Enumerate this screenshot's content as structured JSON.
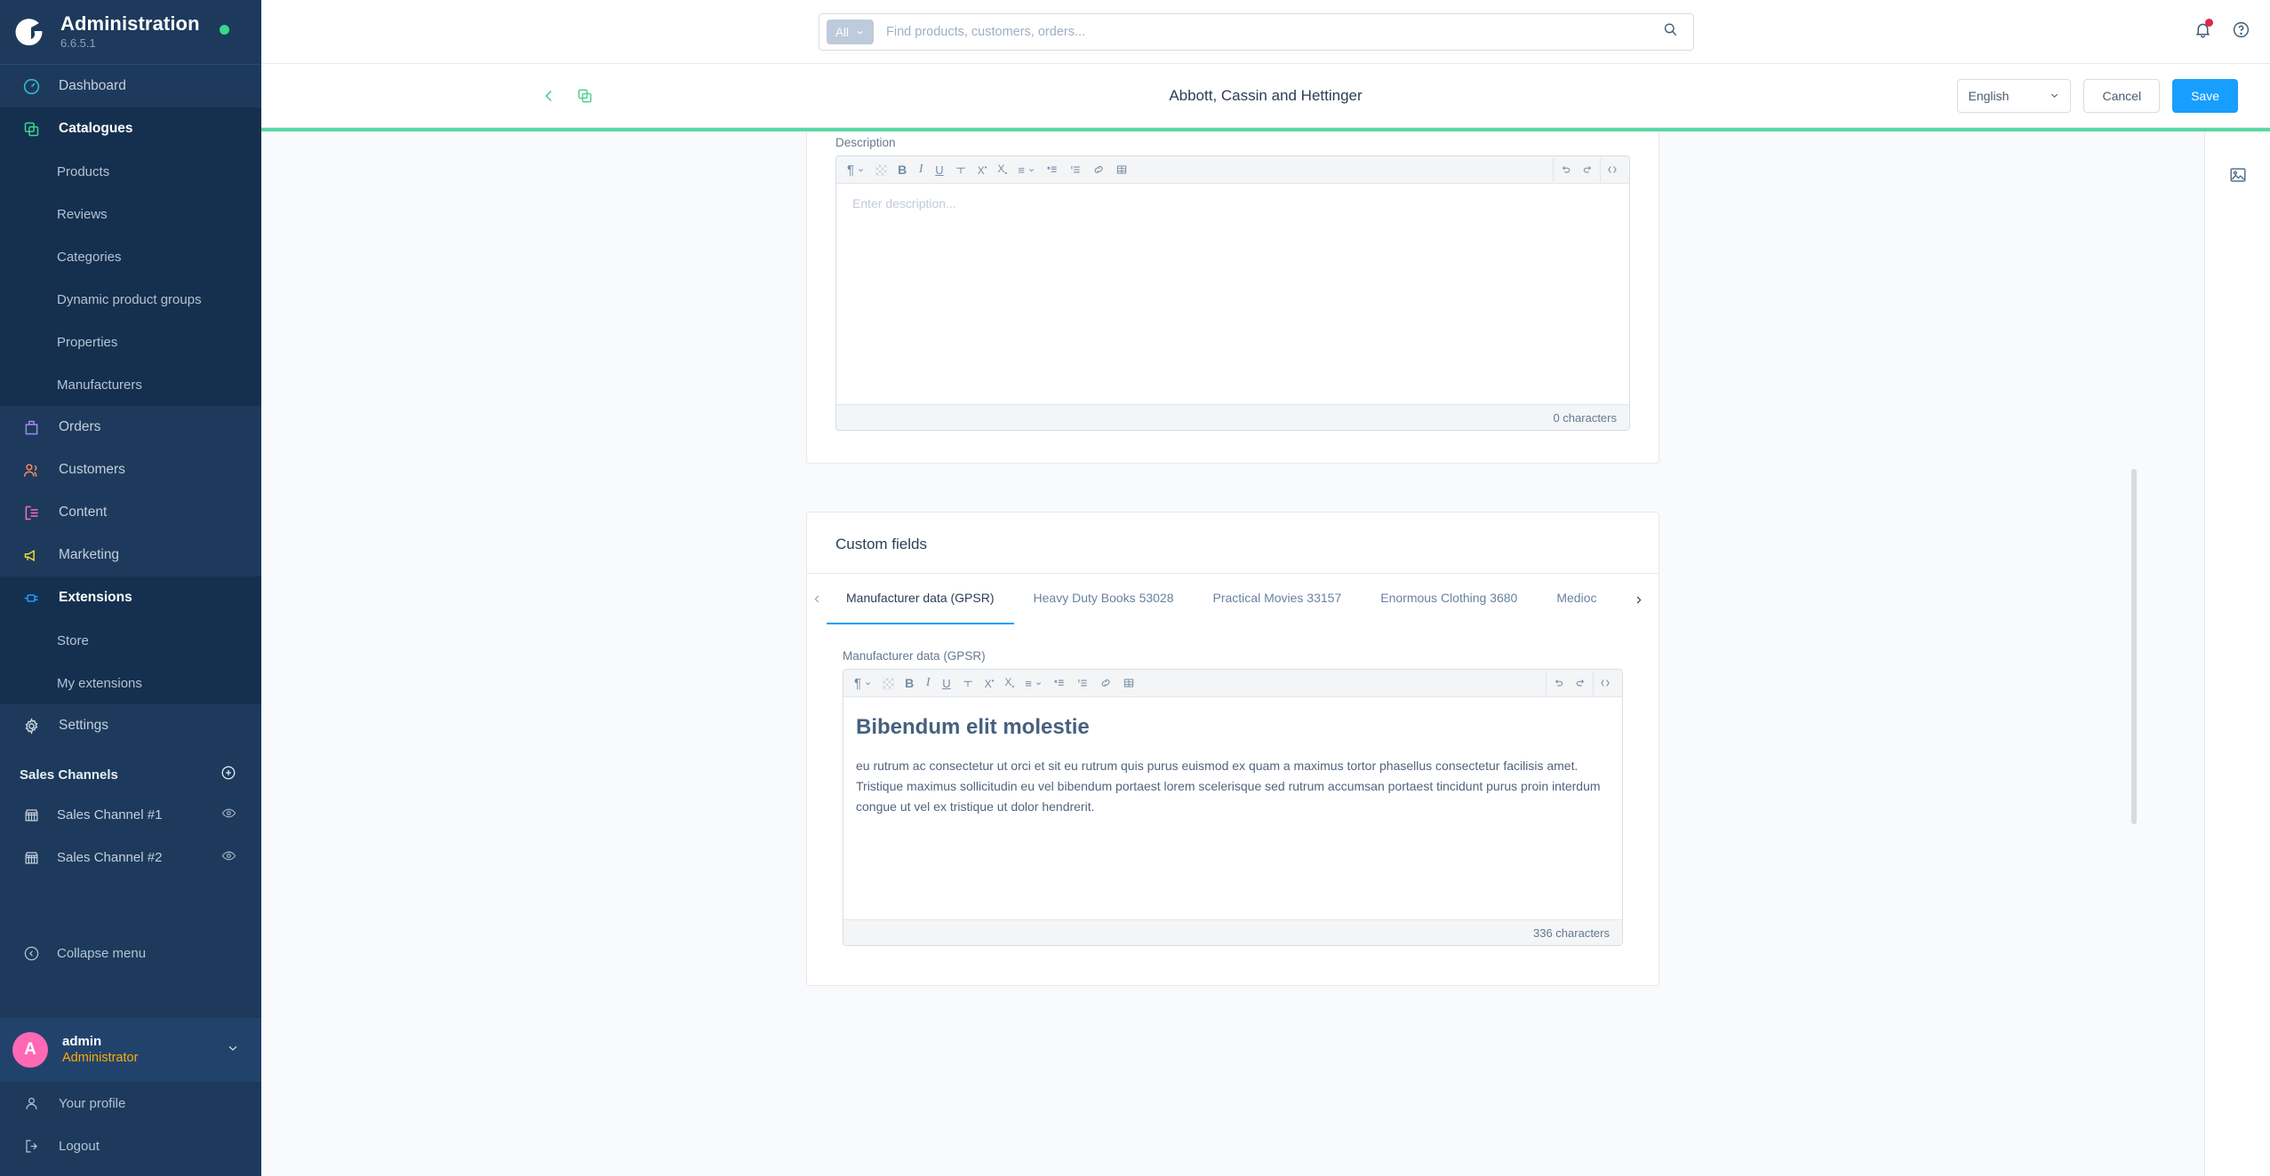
{
  "sidebar": {
    "app_title": "Administration",
    "version": "6.6.5.1",
    "status_dot_color": "#37d88b",
    "nav": [
      {
        "label": "Dashboard",
        "icon": "dashboard-icon",
        "color": "#36c1d6"
      },
      {
        "label": "Catalogues",
        "icon": "catalogues-icon",
        "color": "#37d88b",
        "children": [
          "Products",
          "Reviews",
          "Categories",
          "Dynamic product groups",
          "Properties",
          "Manufacturers"
        ]
      },
      {
        "label": "Orders",
        "icon": "orders-icon",
        "color": "#a18cf0"
      },
      {
        "label": "Customers",
        "icon": "customers-icon",
        "color": "#f88962"
      },
      {
        "label": "Content",
        "icon": "content-icon",
        "color": "#ff6bbd"
      },
      {
        "label": "Marketing",
        "icon": "marketing-icon",
        "color": "#f5d72e"
      },
      {
        "label": "Extensions",
        "icon": "extensions-icon",
        "color": "#189eff",
        "children": [
          "Store",
          "My extensions"
        ]
      },
      {
        "label": "Settings",
        "icon": "settings-icon",
        "color": "#cdd6e0"
      }
    ],
    "sales_channels_title": "Sales Channels",
    "sales_channels": [
      {
        "label": "Sales Channel #1"
      },
      {
        "label": "Sales Channel #2"
      }
    ],
    "collapse_label": "Collapse menu",
    "user": {
      "avatar_initial": "A",
      "avatar_color": "#ff68b4",
      "name": "admin",
      "role": "Administrator",
      "role_color": "#ffa90b"
    },
    "footer_items": [
      {
        "label": "Your profile",
        "icon": "user-icon"
      },
      {
        "label": "Logout",
        "icon": "logout-icon"
      }
    ]
  },
  "topbar": {
    "search_scope": "All",
    "search_placeholder": "Find products, customers, orders...",
    "search_value": "",
    "notification_badge": true
  },
  "smartbar": {
    "title": "Abbott, Cassin and Hettinger",
    "language": "English",
    "cancel_label": "Cancel",
    "save_label": "Save",
    "save_color": "#189eff",
    "progress_color": "#5ad8a6"
  },
  "description_card": {
    "label": "Description",
    "placeholder": "Enter description...",
    "value": "",
    "char_count": "0 characters"
  },
  "custom_fields_card": {
    "title": "Custom fields",
    "tabs": [
      {
        "label": "Manufacturer data (GPSR)",
        "active": true
      },
      {
        "label": "Heavy Duty Books 53028",
        "active": false
      },
      {
        "label": "Practical Movies 33157",
        "active": false
      },
      {
        "label": "Enormous Clothing 3680",
        "active": false
      },
      {
        "label": "Medioc",
        "active": false
      }
    ],
    "field_label": "Manufacturer data (GPSR)",
    "heading": "Bibendum elit molestie",
    "body": "eu rutrum ac consectetur ut orci et sit eu rutrum quis purus euismod ex quam a maximus tortor phasellus consectetur facilisis amet. Tristique maximus sollicitudin eu vel bibendum portaest lorem scelerisque sed rutrum accumsan portaest tincidunt purus proin interdum congue ut vel ex tristique ut dolor hendrerit.",
    "char_count": "336 characters"
  },
  "editor_toolbar": {
    "buttons": [
      {
        "name": "paragraph-format-icon",
        "glyph": "¶",
        "chevron": true
      },
      {
        "name": "text-color-icon",
        "glyph": "",
        "chevron": false
      },
      {
        "name": "bold-icon",
        "glyph": "B",
        "chevron": false
      },
      {
        "name": "italic-icon",
        "glyph": "I",
        "chevron": false
      },
      {
        "name": "underline-icon",
        "glyph": "U",
        "chevron": false
      },
      {
        "name": "strikethrough-icon",
        "glyph": "S",
        "chevron": false
      },
      {
        "name": "superscript-icon",
        "glyph": "X",
        "chevron": false
      },
      {
        "name": "subscript-icon",
        "glyph": "X",
        "chevron": false
      },
      {
        "name": "align-icon",
        "glyph": "≡",
        "chevron": true
      },
      {
        "name": "bullet-list-icon",
        "glyph": "",
        "chevron": false
      },
      {
        "name": "ordered-list-icon",
        "glyph": "",
        "chevron": false
      },
      {
        "name": "link-icon",
        "glyph": "",
        "chevron": false
      },
      {
        "name": "table-icon",
        "glyph": "",
        "chevron": false
      }
    ],
    "right_buttons": [
      {
        "name": "undo-icon"
      },
      {
        "name": "redo-icon"
      },
      {
        "name": "source-code-icon"
      }
    ]
  },
  "right_rail": {
    "icon": "media-image-icon"
  }
}
